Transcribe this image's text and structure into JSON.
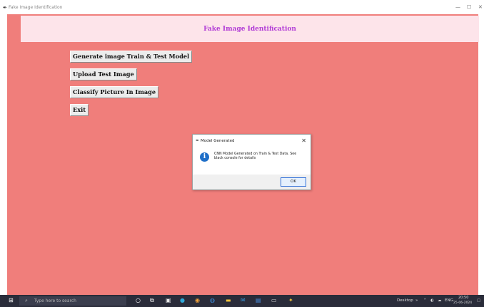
{
  "window": {
    "title": "Fake Image Identification",
    "controls": [
      "—",
      "☐",
      "✕"
    ]
  },
  "header": {
    "title": "Fake Image Identification"
  },
  "buttons": [
    {
      "label": "Generate image Train & Test Model"
    },
    {
      "label": "Upload Test Image"
    },
    {
      "label": "Classify Picture In Image"
    },
    {
      "label": "Exit"
    }
  ],
  "dialog": {
    "title": "Model Generated",
    "message": "CNN Model Generated on Train & Test Data. See black console for details",
    "ok_label": "OK",
    "close_glyph": "✕"
  },
  "taskbar": {
    "search_placeholder": "Type here to search",
    "desktop_label": "Desktop",
    "language": "ENG",
    "time": "20:50",
    "date": "25-06-2024"
  },
  "colors": {
    "background": "#f07e7b",
    "header_bar": "#fde4ea",
    "header_text": "#b13bd6",
    "info_icon": "#1f6fc8",
    "taskbar": "#2a2c3a"
  }
}
